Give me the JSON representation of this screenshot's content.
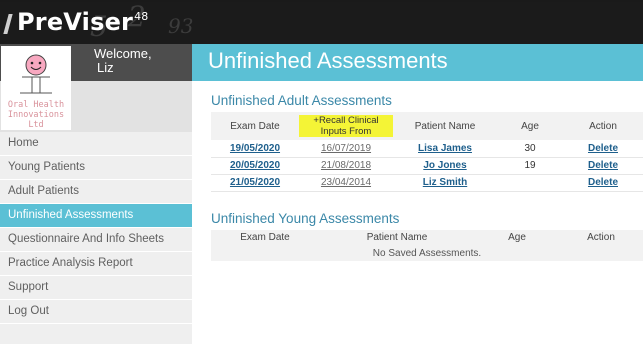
{
  "app": {
    "name": "PreViser",
    "superscript": "48",
    "deco": [
      "5",
      "2",
      "93"
    ]
  },
  "user": {
    "welcome": "Welcome,",
    "name": "Liz",
    "org_name": "Oral Health Innovations Ltd"
  },
  "nav": [
    {
      "label": "Home",
      "active": false
    },
    {
      "label": "Young Patients",
      "active": false
    },
    {
      "label": "Adult Patients",
      "active": false
    },
    {
      "label": "Unfinished Assessments",
      "active": true
    },
    {
      "label": "Questionnaire And Info Sheets",
      "active": false
    },
    {
      "label": "Practice Analysis Report",
      "active": false
    },
    {
      "label": "Support",
      "active": false
    },
    {
      "label": "Log Out",
      "active": false
    }
  ],
  "page_title": "Unfinished Assessments",
  "adult": {
    "title": "Unfinished Adult Assessments",
    "headers": {
      "exam_date": "Exam Date",
      "recall": "+Recall Clinical Inputs From",
      "patient": "Patient Name",
      "age": "Age",
      "action": "Action"
    },
    "rows": [
      {
        "exam_date": "19/05/2020",
        "recall_date": "16/07/2019",
        "patient": "Lisa James",
        "age": "30",
        "action": "Delete"
      },
      {
        "exam_date": "20/05/2020",
        "recall_date": "21/08/2018",
        "patient": "Jo Jones",
        "age": "19",
        "action": "Delete"
      },
      {
        "exam_date": "21/05/2020",
        "recall_date": "23/04/2014",
        "patient": "Liz Smith",
        "age": "",
        "action": "Delete"
      }
    ]
  },
  "young": {
    "title": "Unfinished Young Assessments",
    "headers": {
      "exam_date": "Exam Date",
      "patient": "Patient Name",
      "age": "Age",
      "action": "Action"
    },
    "empty": "No Saved Assessments."
  },
  "colors": {
    "accent": "#5bc0d5",
    "header": "#1b1b1b",
    "link": "#1e5f8c",
    "highlight": "#f4f436"
  }
}
